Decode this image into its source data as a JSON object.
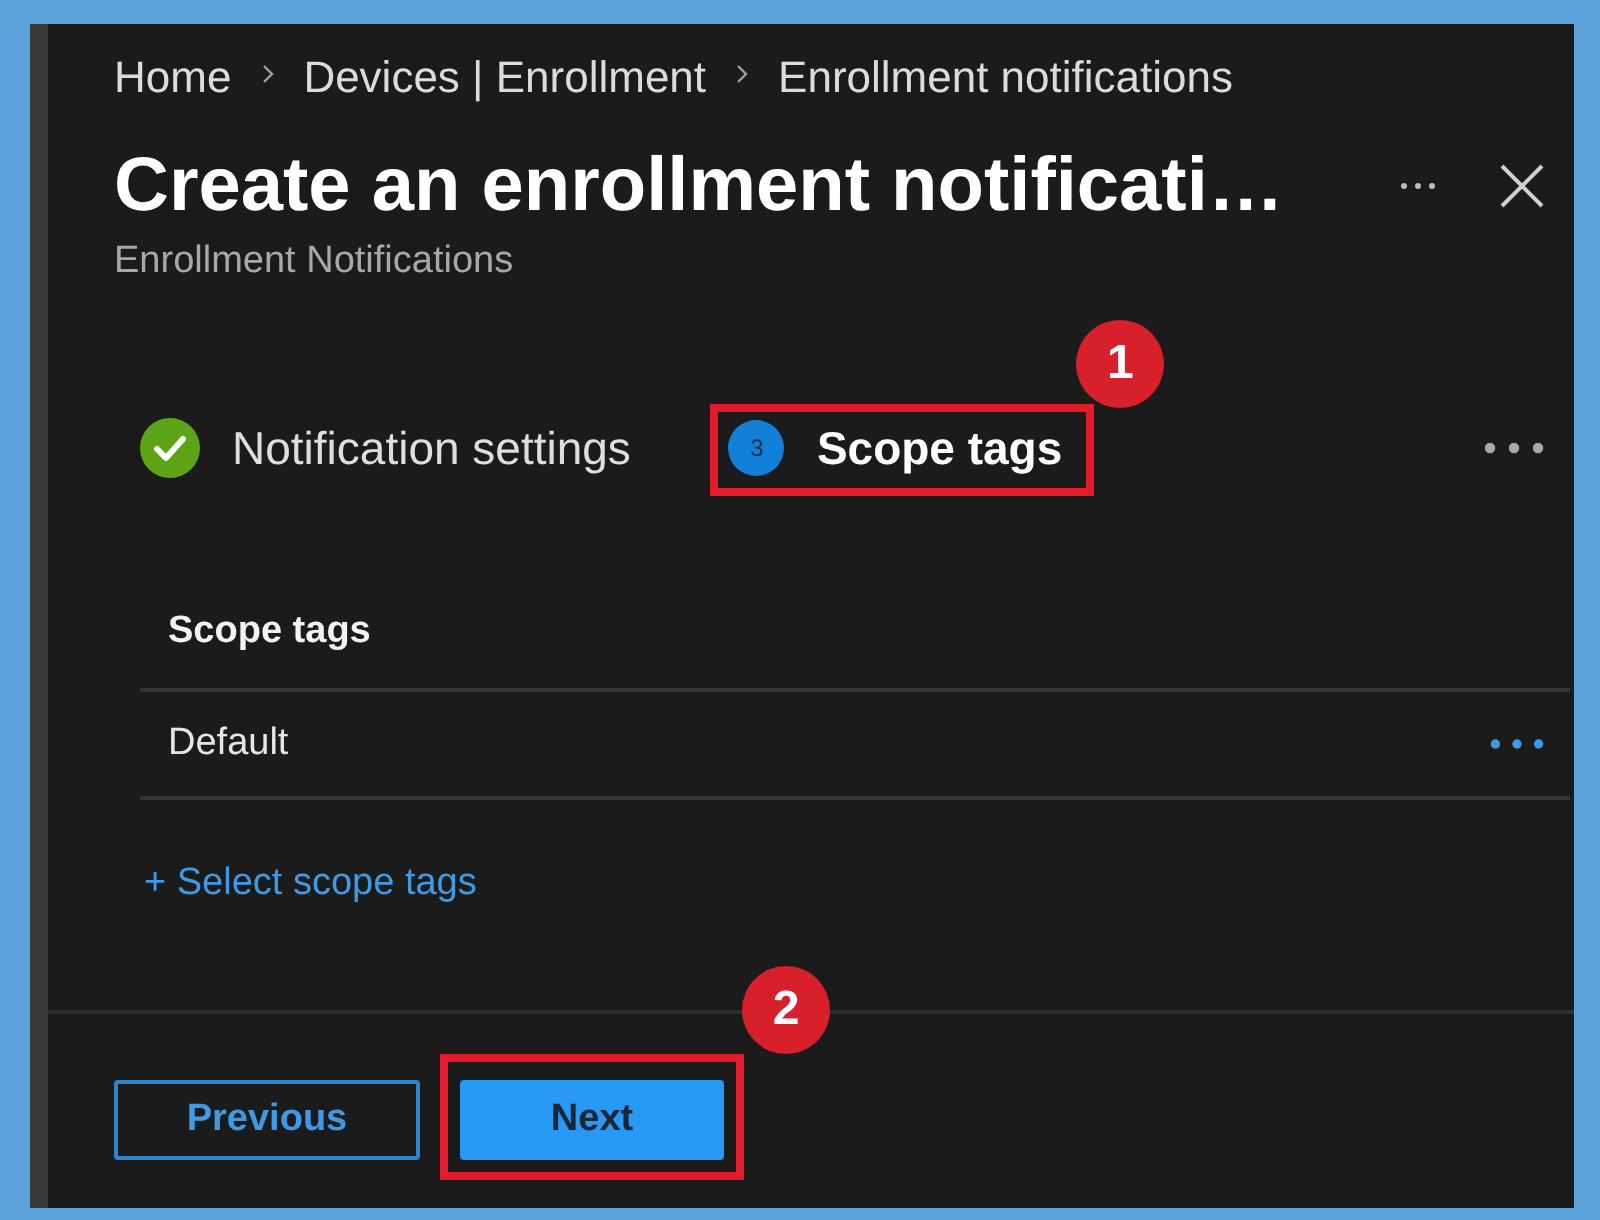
{
  "breadcrumb": [
    {
      "label": "Home"
    },
    {
      "label": "Devices | Enrollment"
    },
    {
      "label": "Enrollment notifications"
    }
  ],
  "header": {
    "title": "Create an enrollment notificati…",
    "subtitle": "Enrollment Notifications"
  },
  "steps": [
    {
      "label": "Notification settings",
      "completed": true,
      "selected": false
    },
    {
      "number": "3",
      "label": "Scope tags",
      "completed": false,
      "selected": true,
      "callout": "1"
    }
  ],
  "table": {
    "columns": [
      "Scope tags"
    ],
    "rows": [
      {
        "cells": [
          "Default"
        ]
      }
    ]
  },
  "add_link": "+ Select scope tags",
  "footer": {
    "buttons": [
      {
        "label": "Previous",
        "kind": "secondary"
      },
      {
        "label": "Next",
        "kind": "primary",
        "callout": "2"
      }
    ]
  }
}
